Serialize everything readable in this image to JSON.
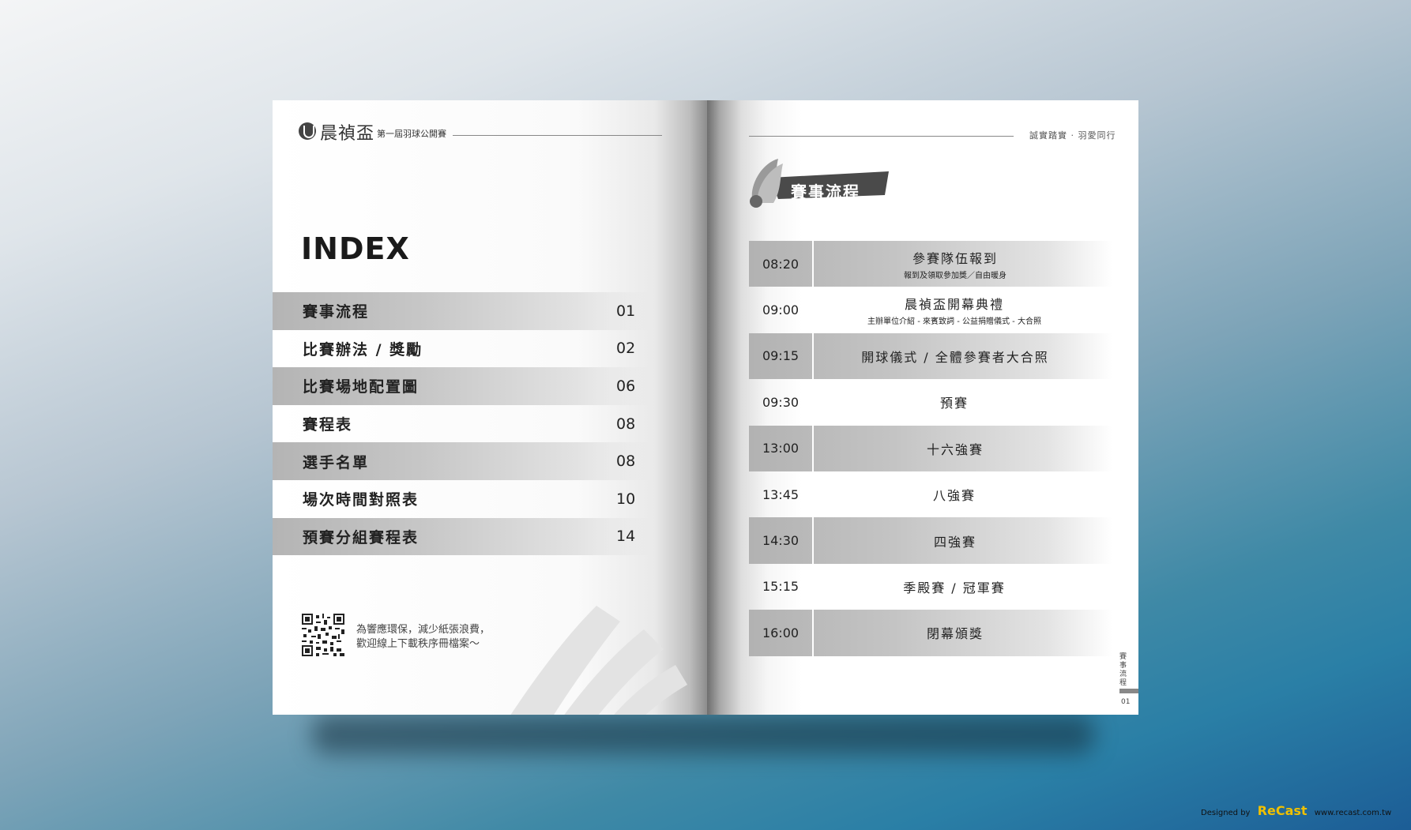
{
  "left_page": {
    "brand_name": "晨禎盃",
    "brand_sub": "第一屆羽球公開賽",
    "index_title": "INDEX",
    "index_items": [
      {
        "label": "賽事流程",
        "page": "01"
      },
      {
        "label": "比賽辦法 / 獎勵",
        "page": "02"
      },
      {
        "label": "比賽場地配置圖",
        "page": "06"
      },
      {
        "label": "賽程表",
        "page": "08"
      },
      {
        "label": "選手名單",
        "page": "08"
      },
      {
        "label": "場次時間對照表",
        "page": "10"
      },
      {
        "label": "預賽分組賽程表",
        "page": "14"
      }
    ],
    "qr_line1": "為響應環保，減少紙張浪費，",
    "qr_line2": "歡迎線上下載秩序冊檔案～"
  },
  "right_page": {
    "slogan": "誠實踏實 · 羽愛同行",
    "section_title": "賽事流程",
    "schedule": [
      {
        "time": "08:20",
        "event": "參賽隊伍報到",
        "sub": "報到及領取參加獎／自由暖身"
      },
      {
        "time": "09:00",
        "event": "晨禎盃開幕典禮",
        "sub": "主辦單位介紹 - 來賓致詞 - 公益捐贈儀式 - 大合照"
      },
      {
        "time": "09:15",
        "event": "開球儀式 / 全體參賽者大合照",
        "sub": ""
      },
      {
        "time": "09:30",
        "event": "預賽",
        "sub": ""
      },
      {
        "time": "13:00",
        "event": "十六強賽",
        "sub": ""
      },
      {
        "time": "13:45",
        "event": "八強賽",
        "sub": ""
      },
      {
        "time": "14:30",
        "event": "四強賽",
        "sub": ""
      },
      {
        "time": "15:15",
        "event": "季殿賽 / 冠軍賽",
        "sub": ""
      },
      {
        "time": "16:00",
        "event": "閉幕頒獎",
        "sub": ""
      }
    ],
    "side_tab": "賽事流程",
    "page_number": "01"
  },
  "credit": {
    "prefix": "Designed by",
    "logo": "ReCast",
    "url": "www.recast.com.tw"
  }
}
